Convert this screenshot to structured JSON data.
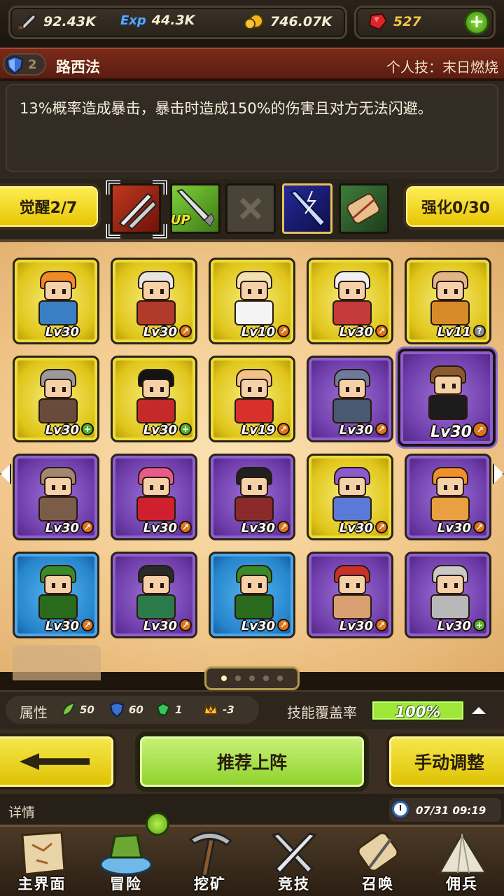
{
  "resources": {
    "attack": "92.43K",
    "exp_icon_text": "Exp",
    "exp": "44.3K",
    "gold": "746.07K",
    "gems": "527"
  },
  "hero": {
    "rank": "2",
    "name": "路西法",
    "skill_title": "个人技：末日燃烧",
    "description": "13%概率造成暴击，暴击时造成150%的伤害且对方无法闪避。"
  },
  "tabs": {
    "awaken_label": "觉醒2/7",
    "enhance_label": "强化0/30",
    "up_tag": "UP"
  },
  "roster": [
    {
      "rarity": "gold",
      "level": "Lv30",
      "badge": "",
      "hair": "#f08a24",
      "outfit": "#3a7fc4"
    },
    {
      "rarity": "gold",
      "level": "Lv30",
      "badge": "up",
      "hair": "#e8e6e0",
      "outfit": "#b23a2a"
    },
    {
      "rarity": "gold",
      "level": "Lv10",
      "badge": "up",
      "hair": "#f2e2b0",
      "outfit": "#f4f4f4"
    },
    {
      "rarity": "gold",
      "level": "Lv30",
      "badge": "up",
      "hair": "#f0f0f0",
      "outfit": "#c43a3a"
    },
    {
      "rarity": "gold",
      "level": "Lv11",
      "badge": "q",
      "hair": "#e2b486",
      "outfit": "#d78a2a"
    },
    {
      "rarity": "gold",
      "level": "Lv30",
      "badge": "plus",
      "hair": "#9a9a9a",
      "outfit": "#6a4a3a"
    },
    {
      "rarity": "gold",
      "level": "Lv30",
      "badge": "plus",
      "hair": "#141414",
      "outfit": "#c42a2a"
    },
    {
      "rarity": "gold",
      "level": "Lv19",
      "badge": "up",
      "hair": "#f2c28a",
      "outfit": "#d8302a"
    },
    {
      "rarity": "purple",
      "level": "Lv30",
      "badge": "up",
      "hair": "#6a7c9a",
      "outfit": "#4a5870"
    },
    {
      "rarity": "purple",
      "level": "Lv30",
      "badge": "up",
      "hair": "#8a5a2a",
      "outfit": "#1c1c1c"
    },
    {
      "rarity": "purple",
      "level": "Lv30",
      "badge": "up",
      "hair": "#a38870",
      "outfit": "#7a5c48"
    },
    {
      "rarity": "purple",
      "level": "Lv30",
      "badge": "up",
      "hair": "#e85a8a",
      "outfit": "#d02030"
    },
    {
      "rarity": "purple",
      "level": "Lv30",
      "badge": "up",
      "hair": "#202020",
      "outfit": "#8a2a2a"
    },
    {
      "rarity": "gold",
      "level": "Lv30",
      "badge": "up",
      "hair": "#8a5ad0",
      "outfit": "#5a7ad8"
    },
    {
      "rarity": "purple",
      "level": "Lv30",
      "badge": "up",
      "hair": "#f0902a",
      "outfit": "#e8a040"
    },
    {
      "rarity": "blue",
      "level": "Lv30",
      "badge": "up",
      "hair": "#3a8a2a",
      "outfit": "#2a6a1c"
    },
    {
      "rarity": "purple",
      "level": "Lv30",
      "badge": "up",
      "hair": "#2a2a2a",
      "outfit": "#2a7a4a"
    },
    {
      "rarity": "blue",
      "level": "Lv30",
      "badge": "up",
      "hair": "#3a8a2a",
      "outfit": "#2a6a1c"
    },
    {
      "rarity": "purple",
      "level": "Lv30",
      "badge": "up",
      "hair": "#c8302a",
      "outfit": "#d8a070"
    },
    {
      "rarity": "purple",
      "level": "Lv30",
      "badge": "plus",
      "hair": "#c8c8c8",
      "outfit": "#b8b8b8"
    }
  ],
  "pager": {
    "count": 5,
    "active": 0
  },
  "attributes": {
    "label": "属性",
    "nature": "50",
    "defense": "60",
    "gem": "1",
    "crown": "-3",
    "coverage_label": "技能覆盖率",
    "coverage_value": "100%",
    "coverage_fraction": 1.0
  },
  "actions": {
    "recommend": "推荐上阵",
    "manual": "手动调整"
  },
  "details": {
    "label": "详情",
    "time": "07/31 09:19"
  },
  "nav": [
    "主界面",
    "冒险",
    "挖矿",
    "竞技",
    "召唤",
    "佣兵"
  ],
  "colors": {
    "gold_card": "#e0c519",
    "purple_card": "#6c3ba8",
    "blue_card": "#2685cc",
    "accent_green": "#9ee63a",
    "button_yellow": "#ebd21a"
  }
}
